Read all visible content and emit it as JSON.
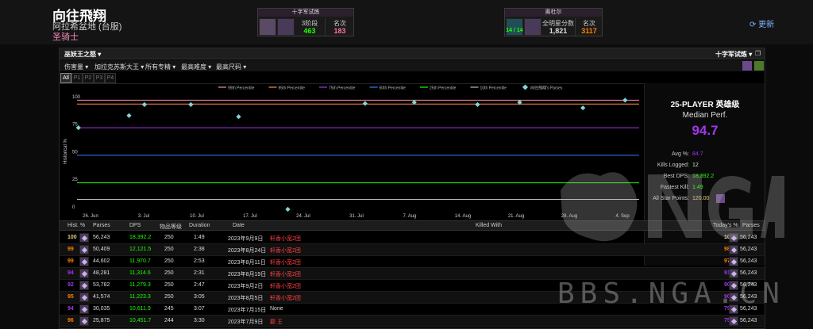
{
  "character": {
    "name": "向往飛翔",
    "realm": "阿拉希盆地 (台服)",
    "class": "圣骑士",
    "class_color": "#f58cba"
  },
  "card1": {
    "title": "十字军试炼",
    "col1_label": "3阶段",
    "col1_value": "463",
    "col2_label": "名次",
    "col2_value": "183"
  },
  "card2": {
    "title": "奥杜尔",
    "badge": "14 / 14",
    "col1_label": "全明星分数",
    "col1_value": "1,821",
    "col2_label": "名次",
    "col2_value": "3117"
  },
  "refresh_label": "更新",
  "raid_select": "巫妖王之怒",
  "zone_select": "十字军试炼",
  "menus": [
    "伤害量",
    "加拉克苏斯大王",
    "所有专精",
    "最高难度",
    "最高尺码"
  ],
  "phases": [
    "All",
    "P1",
    "P2",
    "P3",
    "P4"
  ],
  "legend": [
    "99th Percentile",
    "95th Percentile",
    "75th Percentile",
    "50th Percentile",
    "25th Percentile",
    "10th Percentile",
    "向往飛翔's Parses"
  ],
  "chart_data": {
    "type": "line",
    "ylabel": "Historical %",
    "x_ticks": [
      "26. Jun",
      "3. Jul",
      "10. Jul",
      "17. Jul",
      "24. Jul",
      "31. Jul",
      "7. Aug",
      "14. Aug",
      "21. Aug",
      "28. Aug",
      "4. Sep"
    ],
    "y_ticks": [
      0,
      25,
      50,
      75,
      100
    ],
    "ylim": [
      0,
      105
    ],
    "percentile_lines": [
      {
        "name": "99th Percentile",
        "value": 99,
        "color": "#ff88aa"
      },
      {
        "name": "95th Percentile",
        "value": 95.5,
        "color": "#ff8c40"
      },
      {
        "name": "75th Percentile",
        "value": 74,
        "color": "#a335ee"
      },
      {
        "name": "50th Percentile",
        "value": 49,
        "color": "#2f7fff"
      },
      {
        "name": "25th Percentile",
        "value": 24,
        "color": "#1eff00"
      },
      {
        "name": "10th Percentile",
        "value": 9,
        "color": "#bbbbbb"
      }
    ],
    "parses": [
      {
        "x": 0.2,
        "y": 74
      },
      {
        "x": 7.4,
        "y": 85
      },
      {
        "x": 9.6,
        "y": 95
      },
      {
        "x": 16.2,
        "y": 95
      },
      {
        "x": 23.0,
        "y": 84
      },
      {
        "x": 30.0,
        "y": 0
      },
      {
        "x": 41.0,
        "y": 96
      },
      {
        "x": 48.0,
        "y": 97
      },
      {
        "x": 57.0,
        "y": 95
      },
      {
        "x": 63.0,
        "y": 97
      },
      {
        "x": 72.0,
        "y": 92
      },
      {
        "x": 78.0,
        "y": 99
      }
    ]
  },
  "side_panel": {
    "mode": "25-PLAYER 英雄级",
    "median_label": "Median Perf.",
    "median_value": "94.7",
    "stats": [
      {
        "label": "Avg %:",
        "value": "84.7",
        "color": "#a335ee"
      },
      {
        "label": "Kills Logged:",
        "value": "12",
        "color": "#dddddd"
      },
      {
        "label": "Best DPS:",
        "value": "18,392.2",
        "color": "#1eff00"
      },
      {
        "label": "Fastest Kill:",
        "value": "1:49",
        "color": "#1eff00"
      },
      {
        "label": "All Star Points:",
        "value": "120.00",
        "color": "#e6cc80"
      }
    ]
  },
  "table": {
    "headers": [
      "Hist. %",
      "Parses",
      "DPS",
      "物品等级",
      "Duration",
      "Date",
      "Killed With",
      "Today's %",
      "Parses"
    ],
    "rows": [
      {
        "hist": "100",
        "hist_color": "#e6cc80",
        "parses": "56,243",
        "dps": "18,392.2",
        "ilvl": "250",
        "dur": "1:49",
        "date": "2023年9月9日",
        "killed": "轩香小宽2团",
        "killed_color": "#ff4040",
        "today": "100",
        "today_color": "#e6cc80",
        "parses2": "56,243"
      },
      {
        "hist": "99",
        "hist_color": "#ff8000",
        "parses": "50,409",
        "dps": "12,121.5",
        "ilvl": "250",
        "dur": "2:38",
        "date": "2023年8月24日",
        "killed": "轩香小宽2团",
        "killed_color": "#ff4040",
        "today": "98",
        "today_color": "#ff8000",
        "parses2": "56,243"
      },
      {
        "hist": "99",
        "hist_color": "#ff8000",
        "parses": "44,602",
        "dps": "11,970.7",
        "ilvl": "250",
        "dur": "2:53",
        "date": "2023年8月11日",
        "killed": "轩香小宽2团",
        "killed_color": "#ff4040",
        "today": "97",
        "today_color": "#ff8000",
        "parses2": "56,243"
      },
      {
        "hist": "94",
        "hist_color": "#a335ee",
        "parses": "48,281",
        "dps": "11,314.6",
        "ilvl": "250",
        "dur": "2:31",
        "date": "2023年8月19日",
        "killed": "轩香小宽2团",
        "killed_color": "#ff4040",
        "today": "91",
        "today_color": "#a335ee",
        "parses2": "56,243"
      },
      {
        "hist": "92",
        "hist_color": "#a335ee",
        "parses": "53,782",
        "dps": "11,279.3",
        "ilvl": "250",
        "dur": "2:47",
        "date": "2023年9月2日",
        "killed": "轩香小宽2团",
        "killed_color": "#ff4040",
        "today": "90",
        "today_color": "#a335ee",
        "parses2": "56,243"
      },
      {
        "hist": "95",
        "hist_color": "#ff8000",
        "parses": "41,574",
        "dps": "11,223.3",
        "ilvl": "250",
        "dur": "3:05",
        "date": "2023年8月5日",
        "killed": "轩香小宽2团",
        "killed_color": "#ff4040",
        "today": "90",
        "today_color": "#a335ee",
        "parses2": "56,243"
      },
      {
        "hist": "94",
        "hist_color": "#a335ee",
        "parses": "30,035",
        "dps": "10,611.9",
        "ilvl": "245",
        "dur": "3:07",
        "date": "2023年7月15日",
        "killed": "None",
        "killed_color": "#dddddd",
        "today": "79",
        "today_color": "#a335ee",
        "parses2": "56,243"
      },
      {
        "hist": "96",
        "hist_color": "#ff8000",
        "parses": "25,875",
        "dps": "10,451.7",
        "ilvl": "244",
        "dur": "3:30",
        "date": "2023年7月9日",
        "killed": "巅 王",
        "killed_color": "#ff4040",
        "today": "75",
        "today_color": "#a335ee",
        "parses2": "56,243"
      }
    ]
  },
  "watermark": {
    "text": "BBS.NGA.CN",
    "logo_text": "NGA"
  }
}
